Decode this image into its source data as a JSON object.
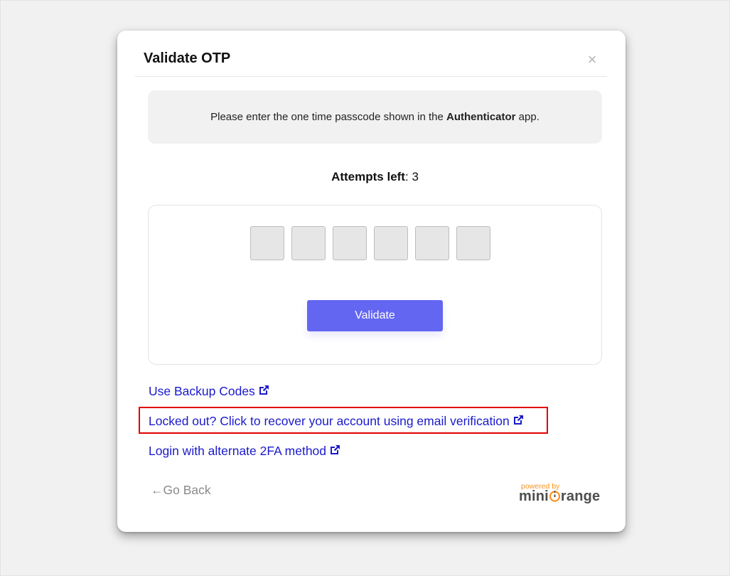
{
  "modal": {
    "title": "Validate OTP",
    "close_glyph": "×"
  },
  "info": {
    "text_before": "Please enter the one time passcode shown in the ",
    "app_name": "Authenticator",
    "text_after": " app."
  },
  "attempts": {
    "label": "Attempts left",
    "separator": ": ",
    "count": "3"
  },
  "otp": {
    "digits": [
      "",
      "",
      "",
      "",
      "",
      ""
    ]
  },
  "buttons": {
    "validate_label": "Validate"
  },
  "links": {
    "backup_codes": "Use Backup Codes",
    "locked_out": "Locked out? Click to recover your account using email verification",
    "alternate_method": "Login with alternate 2FA method",
    "external_icon": "external-link-icon"
  },
  "footer": {
    "go_back_arrow": "←",
    "go_back_label": "Go Back",
    "powered_by": "powered by",
    "brand_prefix": "mini",
    "brand_suffix": "range"
  },
  "colors": {
    "accent": "#6366f1",
    "link": "#1a1acb",
    "highlight": "#e10000",
    "brand_orange": "#f7931e"
  }
}
